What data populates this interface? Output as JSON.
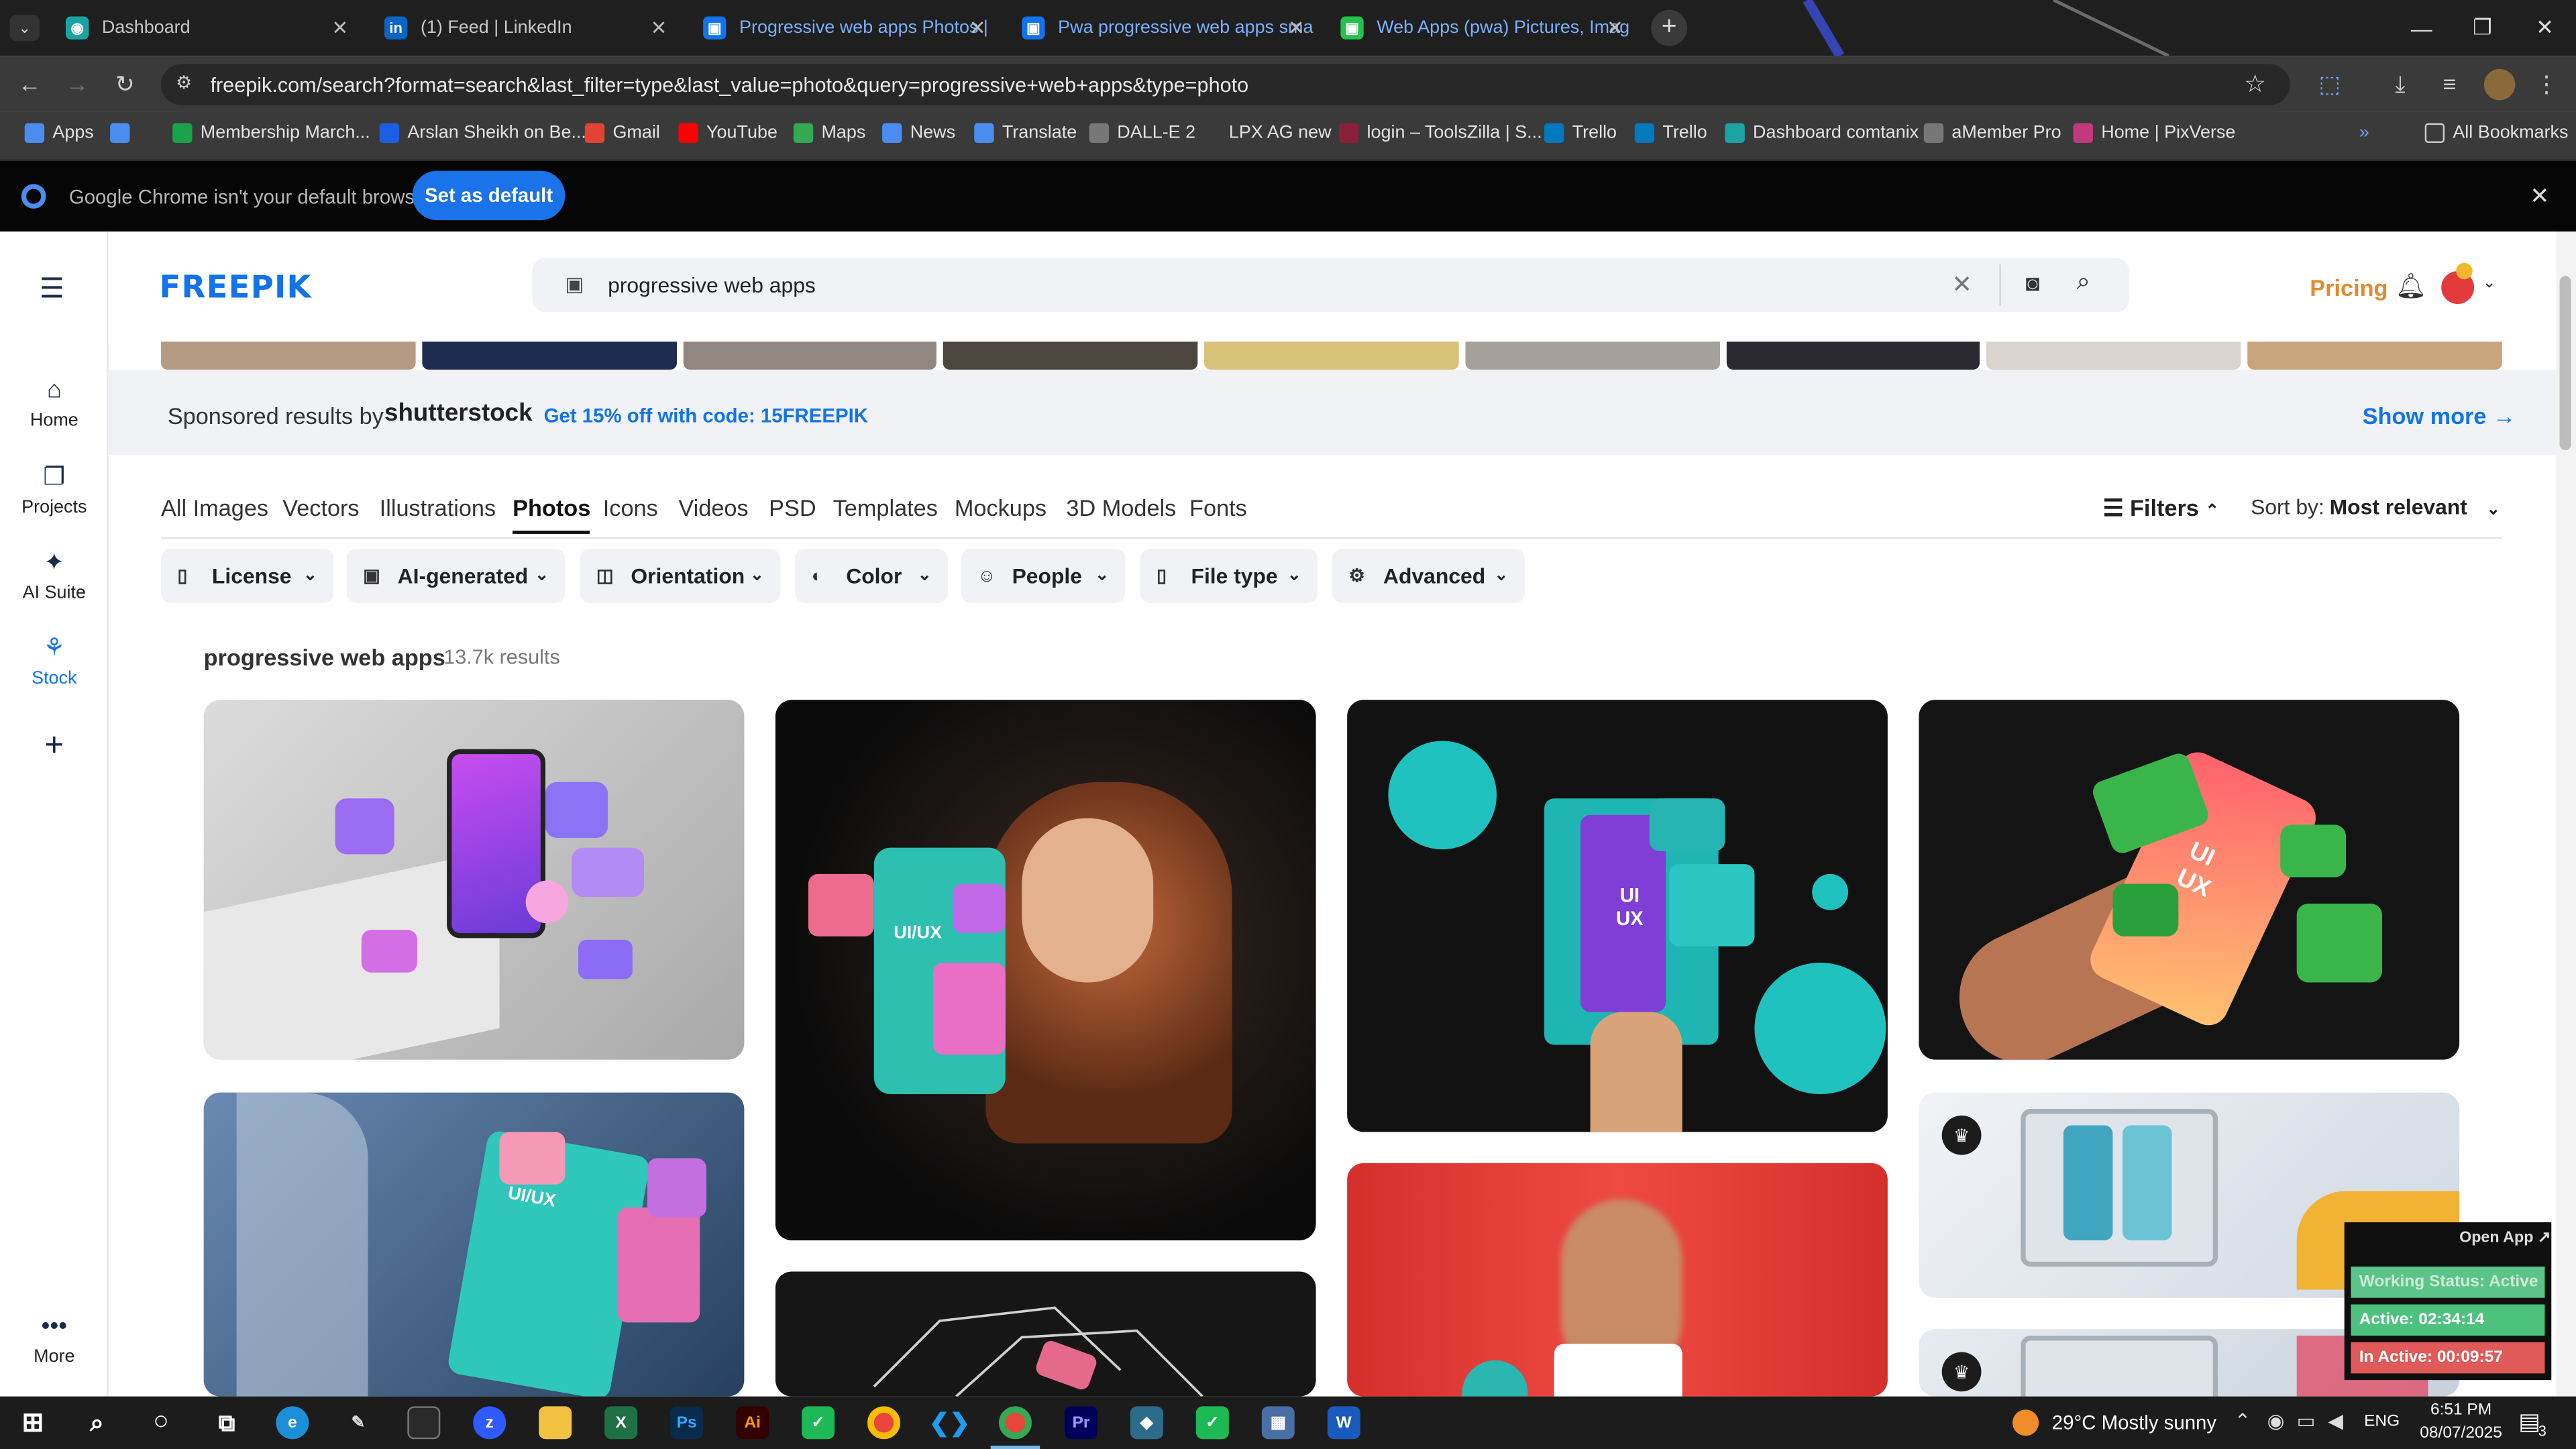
{
  "browser": {
    "tabs": [
      {
        "title": "Dashboard",
        "active": false,
        "favicon_color": "#1aa3a3"
      },
      {
        "title": "(1) Feed | LinkedIn",
        "active": false,
        "favicon_color": "#0a66c2"
      },
      {
        "title": "Progressive web apps Photos | ",
        "active": true,
        "favicon_color": "#1273eb"
      },
      {
        "title": "Pwa progressive web apps sma",
        "active": false,
        "favicon_color": "#1273eb"
      },
      {
        "title": "Web Apps (pwa) Pictures, Imag",
        "active": false,
        "favicon_color": "#25c14e"
      }
    ],
    "url": "freepik.com/search?format=search&last_filter=type&last_value=photo&query=progressive+web+apps&type=photo",
    "bookmarks": [
      {
        "label": "Apps",
        "color": "#4a8cf0"
      },
      {
        "label": "",
        "color": "#4a8cf0"
      },
      {
        "label": "Membership March...",
        "color": "#1aa34a"
      },
      {
        "label": "Arslan Sheikh on Be...",
        "color": "#1b5fe0"
      },
      {
        "label": "Gmail",
        "color": "#e24335"
      },
      {
        "label": "YouTube",
        "color": "#ff0000"
      },
      {
        "label": "Maps",
        "color": "#34a853"
      },
      {
        "label": "News",
        "color": "#4a8cf0"
      },
      {
        "label": "Translate",
        "color": "#4a8cf0"
      },
      {
        "label": "DALL-E 2",
        "color": "#777777"
      },
      {
        "label": "LPX AG new",
        "color": "#3a3a3a"
      },
      {
        "label": "login – ToolsZilla | S...",
        "color": "#8a1f3a"
      },
      {
        "label": "Trello",
        "color": "#0079bf"
      },
      {
        "label": "Trello",
        "color": "#0079bf"
      },
      {
        "label": "Dashboard comtanix",
        "color": "#1aa3a3"
      },
      {
        "label": "aMember Pro",
        "color": "#777777"
      },
      {
        "label": "Home | PixVerse",
        "color": "#c0397b"
      }
    ],
    "all_bookmarks": "All Bookmarks",
    "infobar": {
      "message": "Google Chrome isn't your default browser",
      "button": "Set as default"
    }
  },
  "freepik": {
    "logo": "FREEPIK",
    "sidebar": [
      {
        "label": "Home",
        "icon": "home-icon"
      },
      {
        "label": "Projects",
        "icon": "projects-icon"
      },
      {
        "label": "AI Suite",
        "icon": "sparkle-icon"
      },
      {
        "label": "Stock",
        "icon": "stock-icon"
      },
      {
        "label": "",
        "icon": "plus-icon"
      },
      {
        "label": "More",
        "icon": "more-icon"
      }
    ],
    "search_value": "progressive web apps",
    "pricing": "Pricing",
    "sponsored": {
      "label": "Sponsored results by",
      "brand": "shutterstock",
      "promo": "Get 15% off with code: 15FREEPIK",
      "show_more": "Show more →"
    },
    "content_tabs": [
      "All Images",
      "Vectors",
      "Illustrations",
      "Photos",
      "Icons",
      "Videos",
      "PSD",
      "Templates",
      "Mockups",
      "3D Models",
      "Fonts"
    ],
    "active_tab": "Photos",
    "filters_label": "Filters",
    "sort_label": "Sort by:",
    "sort_value": "Most relevant",
    "filter_buttons": [
      "License",
      "AI-generated",
      "Orientation",
      "Color",
      "People",
      "File type",
      "Advanced"
    ],
    "results_title": "progressive web apps",
    "results_count": "13.7k results",
    "image_cards": [
      {
        "text": "",
        "bg": "#c9c9c9",
        "accent": "#b45cf0"
      },
      {
        "text": "UI/UX",
        "bg": "#111111",
        "accent": "#22b8a8"
      },
      {
        "text": "UI UX",
        "bg": "#151515",
        "accent": "#22c2bf"
      },
      {
        "text": "UI UX",
        "bg": "#141414",
        "accent": "#39b54a"
      },
      {
        "text": "UI/UX",
        "bg": "#3e5d84",
        "accent": "#e66fb4"
      },
      {
        "text": "",
        "bg": "#d9e2ea",
        "accent": "#36a3c2"
      },
      {
        "text": "",
        "bg": "#1a1a1a",
        "accent": "#e56a8a"
      },
      {
        "text": "",
        "bg": "#e23b34",
        "accent": "#2bb6b0"
      },
      {
        "text": "",
        "bg": "#e5e9ee",
        "accent": "#f2b233"
      }
    ]
  },
  "tracker": {
    "open_app": "Open App ↗",
    "working_status": "Working Status: Active",
    "active": "Active: 02:34:14",
    "inactive": "In Active: 00:09:57"
  },
  "taskbar": {
    "weather": "29°C  Mostly sunny",
    "lang": "ENG",
    "time": "6:51 PM",
    "date": "08/07/2025",
    "notifications": "3"
  }
}
